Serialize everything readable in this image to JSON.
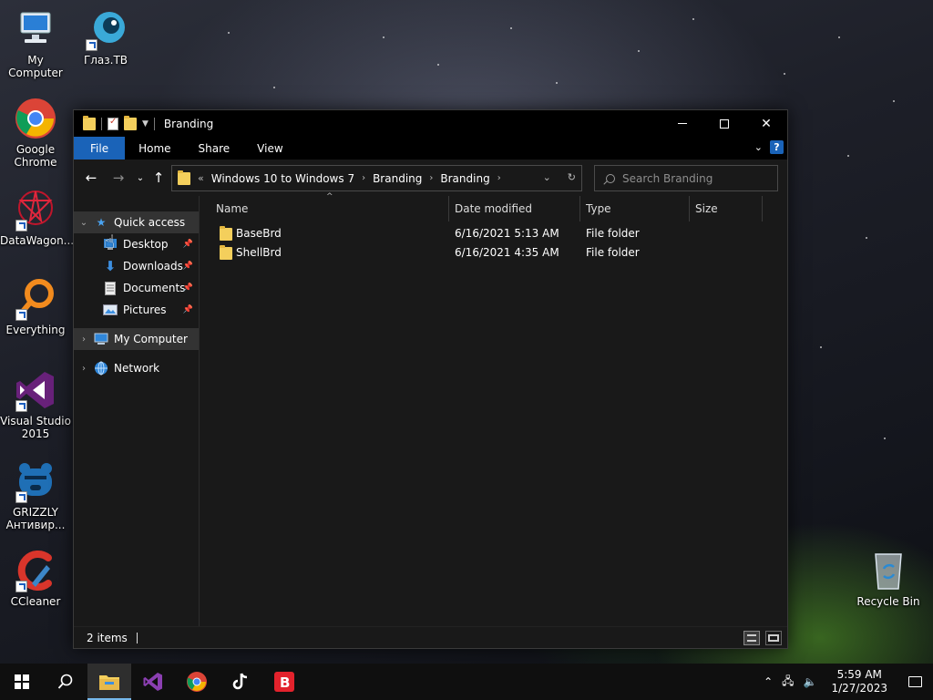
{
  "desktop": {
    "icons": [
      {
        "label": "My Computer",
        "icon": "computer-icon"
      },
      {
        "label": "Глаз.ТВ",
        "icon": "glaz-tv-icon"
      },
      {
        "label": "Google Chrome",
        "icon": "chrome-icon"
      },
      {
        "label": "DataWagon...",
        "icon": "datawagon-icon"
      },
      {
        "label": "Everything",
        "icon": "everything-search-icon"
      },
      {
        "label": "Visual Studio 2015",
        "icon": "visual-studio-icon"
      },
      {
        "label": "GRIZZLY Антивир...",
        "icon": "grizzly-icon"
      },
      {
        "label": "CCleaner",
        "icon": "ccleaner-icon"
      },
      {
        "label": "Recycle Bin",
        "icon": "recycle-bin-icon"
      }
    ]
  },
  "window": {
    "title": "Branding",
    "ribbon": {
      "tabs": [
        "File",
        "Home",
        "Share",
        "View"
      ],
      "help": "?"
    },
    "address": {
      "overflow": "«",
      "breadcrumbs": [
        "Windows 10 to Windows 7",
        "Branding",
        "Branding"
      ]
    },
    "search": {
      "placeholder": "Search Branding"
    },
    "nav_pane": {
      "quick_access": "Quick access",
      "pinned": [
        "Desktop",
        "Downloads",
        "Documents",
        "Pictures"
      ],
      "my_computer": "My Computer",
      "network": "Network"
    },
    "columns": [
      "Name",
      "Date modified",
      "Type",
      "Size"
    ],
    "files": [
      {
        "name": "BaseBrd",
        "date": "6/16/2021 5:13 AM",
        "type": "File folder",
        "size": ""
      },
      {
        "name": "ShellBrd",
        "date": "6/16/2021 4:35 AM",
        "type": "File folder",
        "size": ""
      }
    ],
    "status": {
      "items": "2 items"
    }
  },
  "taskbar": {
    "apps": [
      "start",
      "search",
      "file-explorer",
      "visual-studio",
      "chrome",
      "tiktok",
      "bitdefender"
    ],
    "time": "5:59 AM",
    "date": "1/27/2023"
  },
  "colors": {
    "accent": "#1a63b8",
    "folder": "#f4cf5c",
    "window_bg": "#191919",
    "selection": "#333333"
  }
}
